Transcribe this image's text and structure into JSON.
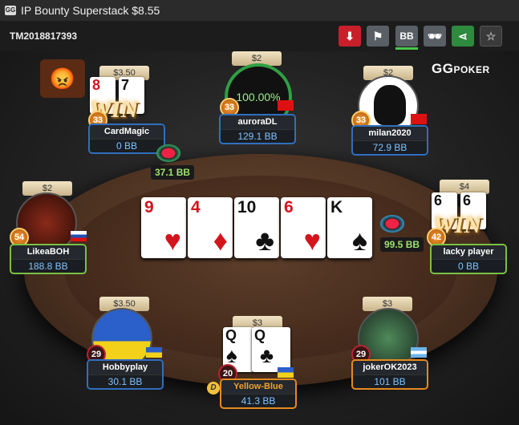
{
  "window": {
    "logo": "GG",
    "title": "IP  Bounty Superstack $8.55"
  },
  "toolbar": {
    "table_id": "TM2018817393",
    "buttons": [
      {
        "icon": "download-icon",
        "glyph": "⬇"
      },
      {
        "icon": "report-flag-icon",
        "glyph": "⚑"
      },
      {
        "icon": "bb-toggle",
        "label": "BB"
      },
      {
        "icon": "incognito-icon",
        "glyph": "🕶"
      },
      {
        "icon": "share-icon",
        "glyph": "⋖"
      },
      {
        "icon": "star-icon",
        "glyph": "☆"
      }
    ]
  },
  "brand": {
    "main": "GG",
    "sub": "POKER"
  },
  "board": [
    {
      "rank": "9",
      "suit": "♥",
      "color": "red"
    },
    {
      "rank": "4",
      "suit": "♦",
      "color": "red"
    },
    {
      "rank": "10",
      "suit": "♣",
      "color": "black"
    },
    {
      "rank": "6",
      "suit": "♥",
      "color": "red"
    },
    {
      "rank": "K",
      "suit": "♠",
      "color": "black"
    }
  ],
  "pots": {
    "left": "37.1 BB",
    "right": "99.5 BB"
  },
  "seats": {
    "cardmagic": {
      "name": "CardMagic",
      "stack": "0 BB",
      "bounty": "$3.50",
      "level": "33",
      "cards": [
        "8",
        "7"
      ],
      "win": "WIN"
    },
    "aurora": {
      "name": "auroraDL",
      "stack": "129.1 BB",
      "bounty": "$2",
      "level": "33",
      "equity": "100.00%"
    },
    "milan": {
      "name": "milan2020",
      "stack": "72.9 BB",
      "bounty": "$2",
      "level": "33"
    },
    "likea": {
      "name": "LikeaBOH",
      "stack": "188.8 BB",
      "bounty": "$2",
      "level": "54"
    },
    "lacky": {
      "name": "lacky player",
      "stack": "0 BB",
      "bounty": "$4",
      "level": "42",
      "cards": [
        "6",
        "6"
      ],
      "win": "WIN"
    },
    "hobby": {
      "name": "Hobbyplay",
      "stack": "30.1 BB",
      "bounty": "$3.50",
      "level": "29"
    },
    "yellow": {
      "name": "Yellow-Blue",
      "stack": "41.3 BB",
      "bounty": "$3",
      "level": "20",
      "cards": [
        "Q",
        "Q"
      ],
      "dealer": "D"
    },
    "joker": {
      "name": "jokerOK2023",
      "stack": "101 BB",
      "bounty": "$3",
      "level": "29"
    }
  }
}
